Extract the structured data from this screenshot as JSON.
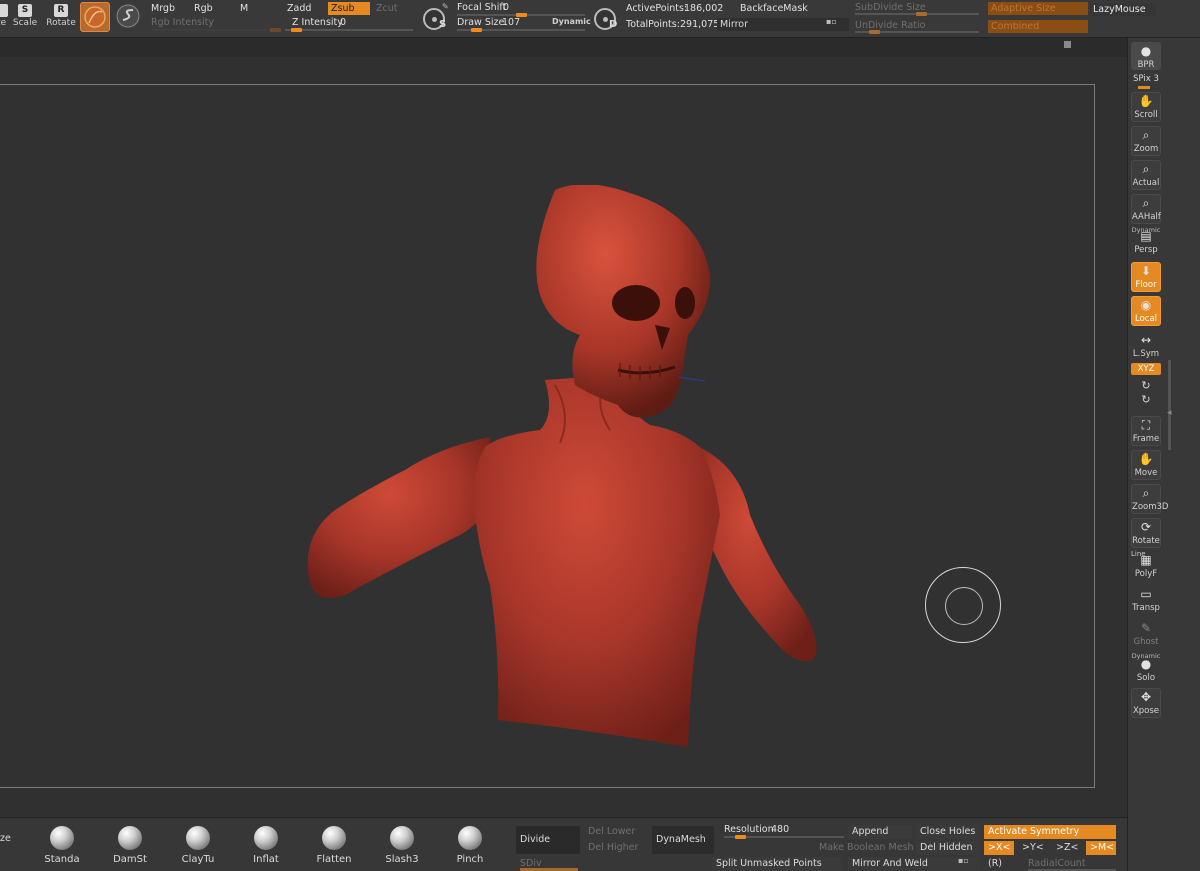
{
  "top": {
    "tools": [
      {
        "glyph": "",
        "label": "ze"
      },
      {
        "glyph": "S",
        "label": "Scale"
      },
      {
        "glyph": "R",
        "label": "Rotate"
      }
    ],
    "modes": {
      "mrgb": "Mrgb",
      "rgb": "Rgb",
      "m": "M",
      "zadd": "Zadd",
      "zsub": "Zsub",
      "zcut": "Zcut",
      "rgb_intensity": "Rgb Intensity",
      "z_intensity_label": "Z Intensity",
      "z_intensity_value": "0",
      "z_intensity_level": 0.05
    },
    "dial_s": "S",
    "focal_shift_label": "Focal Shift",
    "focal_shift_value": "0",
    "focal_shift_level": 0.5,
    "draw_size_label": "Draw Size",
    "draw_size_value": "107",
    "draw_size_level": 0.12,
    "dynamic": "Dynamic",
    "dial_d": "D",
    "active_points_label": "ActivePoints:",
    "active_points_value": "186,002",
    "total_points_label": "TotalPoints:",
    "total_points_value": "291,075",
    "backface_mask": "BackfaceMask",
    "mirror": "Mirror",
    "subdivide_size": "SubDivide Size",
    "undivide_ratio": "UnDivide Ratio",
    "adaptive_size": "Adaptive Size",
    "combined": "Combined",
    "lazy_mouse": "LazyMouse"
  },
  "right": {
    "bpr": "BPR",
    "spix_label": "SPix",
    "spix_value": "3",
    "buttons": [
      {
        "label": "Scroll",
        "icon": "hand-icon"
      },
      {
        "label": "Zoom",
        "icon": "magnifier-icon"
      },
      {
        "label": "Actual",
        "icon": "magnifier-icon"
      },
      {
        "label": "AAHalf",
        "icon": "magnifier-icon"
      },
      {
        "label": "Persp",
        "icon": "grid-icon",
        "top": "Dynamic"
      },
      {
        "label": "Floor",
        "icon": "floor-icon"
      },
      {
        "label": "Local",
        "icon": "local-icon"
      },
      {
        "label": "L.Sym",
        "icon": "arrows-icon"
      },
      {
        "label": "Frame",
        "icon": "frame-icon"
      },
      {
        "label": "Move",
        "icon": "hand-icon"
      },
      {
        "label": "Zoom3D",
        "icon": "magnifier-icon"
      },
      {
        "label": "Rotate",
        "icon": "rotate-icon"
      },
      {
        "label": "PolyF",
        "icon": "grid-icon",
        "top": "Line"
      },
      {
        "label": "Transp",
        "icon": "transp-icon"
      },
      {
        "label": "Ghost",
        "icon": "ghost-icon"
      },
      {
        "label": "Solo",
        "icon": "solo-icon",
        "top": "Dynamic"
      },
      {
        "label": "Xpose",
        "icon": "xpose-icon"
      }
    ],
    "xyz": "XYZ"
  },
  "brushes": [
    "Standa",
    "DamSt",
    "ClayTu",
    "Inflat",
    "Flatten",
    "Slash3",
    "Pinch"
  ],
  "brush_partial": "ze",
  "geometry": {
    "divide": "Divide",
    "del_lower": "Del Lower",
    "del_higher": "Del Higher",
    "sdiv": "SDiv",
    "dynamesh": "DynaMesh",
    "resolution_label": "Resolution",
    "resolution_value": "480",
    "resolution_level": 0.1,
    "append": "Append",
    "close_holes": "Close Holes",
    "activate_symmetry": "Activate Symmetry",
    "make_boolean_mesh": "Make Boolean Mesh",
    "del_hidden": "Del Hidden",
    "x_sym": ">X<",
    "y_sym": ">Y<",
    "z_sym": ">Z<",
    "m_sym": ">M<",
    "split_unmasked": "Split Unmasked Points",
    "mirror_and_weld": "Mirror And Weld",
    "r_label": "(R)",
    "radial_count": "RadialCount"
  },
  "colors": {
    "accent": "#e58a22",
    "model": "#b6392a",
    "canvas": "#303030"
  }
}
